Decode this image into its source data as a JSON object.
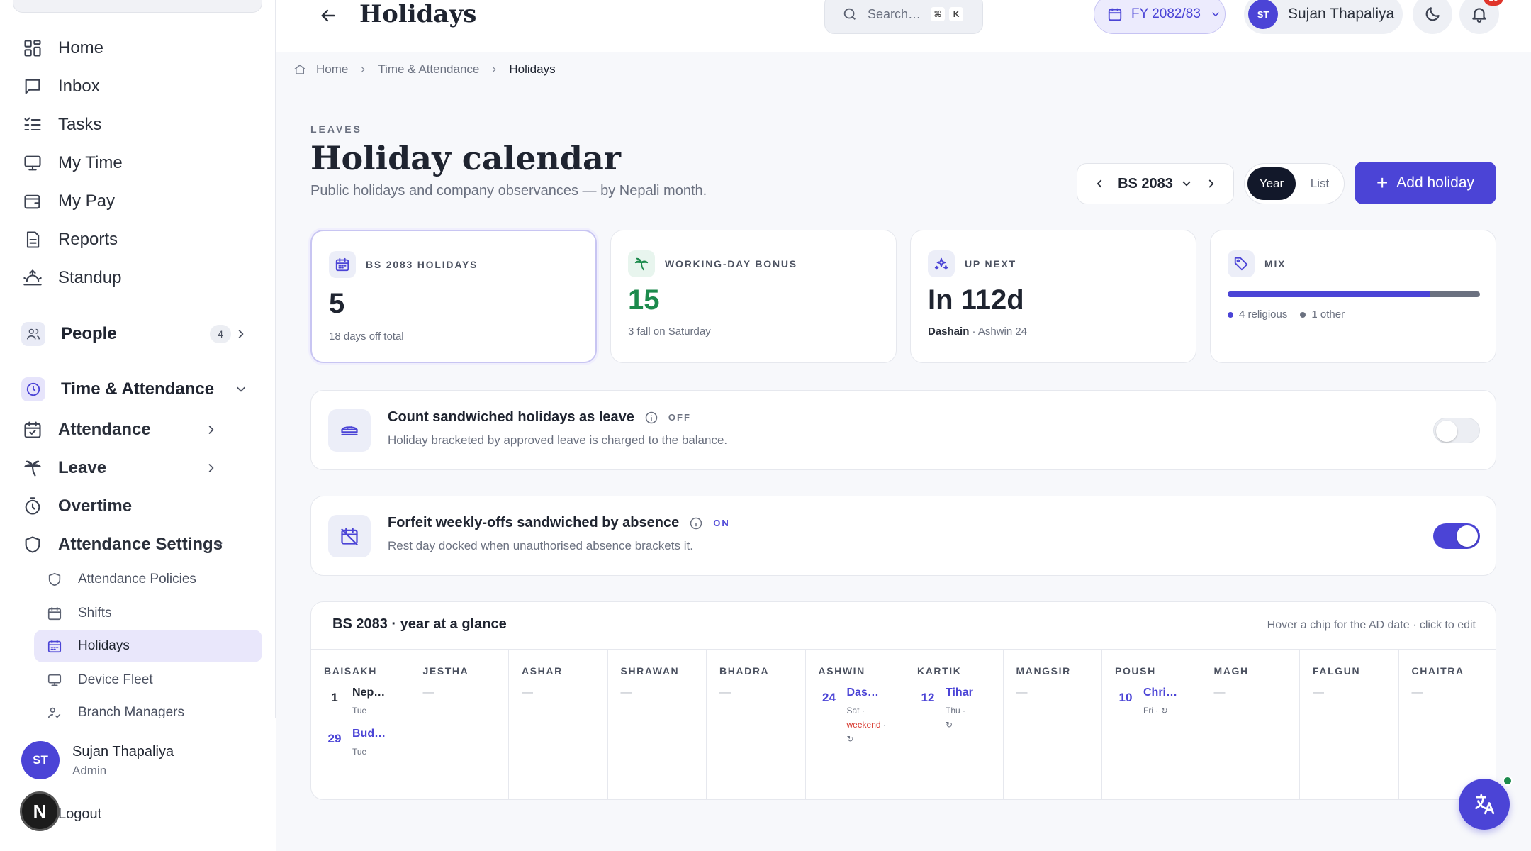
{
  "sidebar": {
    "nav": [
      {
        "label": "Home",
        "icon": "grid-icon"
      },
      {
        "label": "Inbox",
        "icon": "message-icon"
      },
      {
        "label": "Tasks",
        "icon": "list-check-icon"
      },
      {
        "label": "My Time",
        "icon": "monitor-icon"
      },
      {
        "label": "My Pay",
        "icon": "wallet-icon"
      },
      {
        "label": "Reports",
        "icon": "document-icon"
      },
      {
        "label": "Standup",
        "icon": "sunrise-icon"
      }
    ],
    "people": {
      "label": "People",
      "count": "4"
    },
    "time_attendance": {
      "label": "Time & Attendance"
    },
    "ta_items": [
      {
        "label": "Attendance"
      },
      {
        "label": "Leave"
      },
      {
        "label": "Overtime"
      }
    ],
    "settings_group": {
      "label": "Attendance Settings"
    },
    "settings_items": [
      {
        "label": "Attendance Policies"
      },
      {
        "label": "Shifts"
      },
      {
        "label": "Holidays"
      },
      {
        "label": "Device Fleet"
      },
      {
        "label": "Branch Managers"
      }
    ],
    "user": {
      "initials": "ST",
      "name": "Sujan Thapaliya",
      "role": "Admin"
    },
    "logout_label": "Logout",
    "bubble_letter": "N"
  },
  "topbar": {
    "title": "Holidays",
    "search_placeholder": "Search…",
    "kbd1": "⌘",
    "kbd2": "K",
    "fy": "FY 2082/83",
    "user_initials": "ST",
    "user_name": "Sujan Thapaliya",
    "notif_count": "13"
  },
  "breadcrumb": {
    "home": "Home",
    "section": "Time & Attendance",
    "current": "Holidays"
  },
  "header": {
    "eyebrow": "LEAVES",
    "title": "Holiday calendar",
    "subtitle": "Public holidays and company observances — by Nepali month.",
    "year": "BS 2083",
    "view_year": "Year",
    "view_list": "List",
    "add_label": "Add holiday"
  },
  "stats": {
    "holidays": {
      "label": "BS 2083 HOLIDAYS",
      "value": "5",
      "note": "18 days off total"
    },
    "bonus": {
      "label": "WORKING-DAY BONUS",
      "value": "15",
      "note": "3 fall on Saturday"
    },
    "next": {
      "label": "UP NEXT",
      "value": "In 112d",
      "note_bold": "Dashain",
      "note": " · Ashwin 24"
    },
    "mix": {
      "label": "MIX",
      "religious_fraction": 0.8,
      "religious": "4 religious",
      "other": "1 other"
    }
  },
  "settings": {
    "sandwich": {
      "title": "Count sandwiched holidays as leave",
      "state": "OFF",
      "desc": "Holiday bracketed by approved leave is charged to the balance.",
      "enabled": false
    },
    "forfeit": {
      "title": "Forfeit weekly-offs sandwiched by absence",
      "state": "ON",
      "desc": "Rest day docked when unauthorised absence brackets it.",
      "enabled": true
    }
  },
  "glance": {
    "title": "BS 2083 · year at a glance",
    "hint": "Hover a chip for the AD date · click to edit",
    "empty": "—",
    "months": [
      {
        "name": "BAISAKH",
        "holidays": [
          {
            "day": "1",
            "name": "Nep…",
            "meta": "Tue",
            "accent": false
          },
          {
            "day": "29",
            "name": "Bud…",
            "meta": "Tue",
            "accent": true
          }
        ]
      },
      {
        "name": "JESTHA",
        "holidays": []
      },
      {
        "name": "ASHAR",
        "holidays": []
      },
      {
        "name": "SHRAWAN",
        "holidays": []
      },
      {
        "name": "BHADRA",
        "holidays": []
      },
      {
        "name": "ASHWIN",
        "holidays": [
          {
            "day": "24",
            "name": "Das…",
            "meta": "Sat ·",
            "weekend": "weekend",
            "recurring": "↻",
            "accent": true
          }
        ]
      },
      {
        "name": "KARTIK",
        "holidays": [
          {
            "day": "12",
            "name": "Tihar",
            "meta": "Thu ·",
            "recurring": "↻",
            "accent": true
          }
        ]
      },
      {
        "name": "MANGSIR",
        "holidays": []
      },
      {
        "name": "POUSH",
        "holidays": [
          {
            "day": "10",
            "name": "Chri…",
            "meta": "Fri · ↻",
            "accent": true
          }
        ]
      },
      {
        "name": "MAGH",
        "holidays": []
      },
      {
        "name": "FALGUN",
        "holidays": []
      },
      {
        "name": "CHAITRA",
        "holidays": []
      }
    ]
  },
  "colors": {
    "accent": "#4b44d6",
    "success": "#1c8a4c",
    "danger": "#d6362c"
  }
}
